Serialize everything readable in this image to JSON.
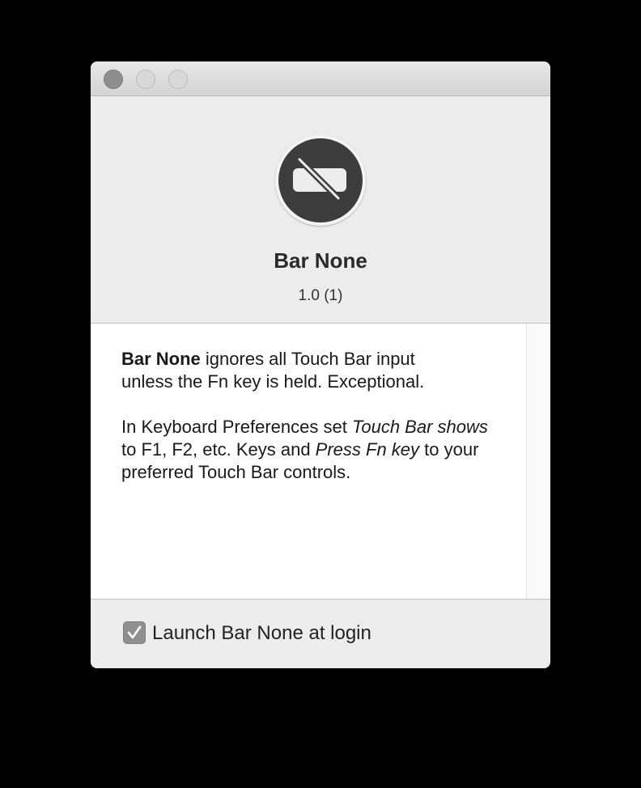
{
  "window": {
    "buttons": [
      "close",
      "minimize",
      "zoom"
    ]
  },
  "app": {
    "name": "Bar None",
    "version": "1.0 (1)",
    "icon": "touch-bar-disabled-icon"
  },
  "description": {
    "p1_bold": "Bar None",
    "p1_rest_line1": " ignores all Touch Bar input",
    "p1_rest_line2": "unless the Fn key is held. Exceptional.",
    "p2_a": "In Keyboard Preferences set ",
    "p2_b_italic": "Touch Bar shows",
    "p2_c": " to F1, F2, etc. Keys and ",
    "p2_d_italic": "Press Fn key",
    "p2_e": " to your preferred Touch Bar controls."
  },
  "footer": {
    "launch_at_login_label": "Launch Bar None at login",
    "launch_at_login_checked": true
  }
}
